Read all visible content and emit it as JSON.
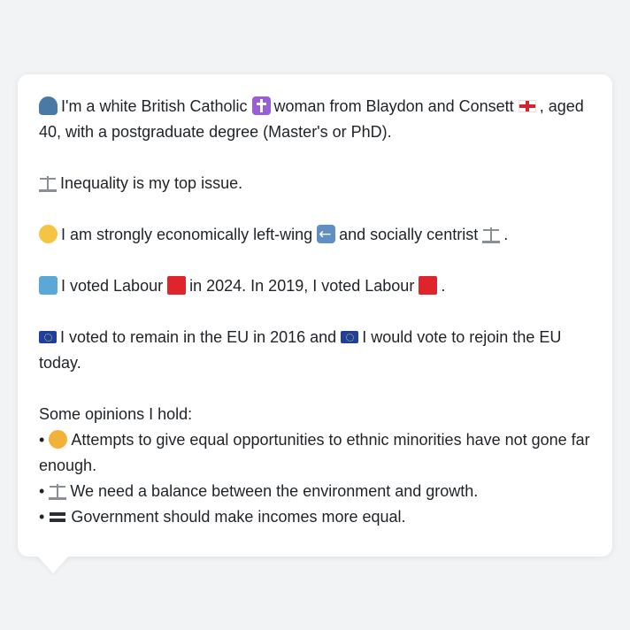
{
  "profile": {
    "intro_1": "I'm a white British Catholic",
    "intro_2": "woman from Blaydon and Consett",
    "intro_3": ", aged 40, with a postgraduate degree (Master's or PhD).",
    "top_issue": "Inequality is my top issue.",
    "ideology_1": "I am strongly economically left-wing",
    "ideology_2": "and socially centrist",
    "ideology_3": ".",
    "vote_1": "I voted Labour",
    "vote_2": "in 2024. In 2019, I voted Labour",
    "vote_3": ".",
    "eu_1": "I voted to remain in the EU in 2016 and",
    "eu_2": "I would vote to rejoin the EU today.",
    "opinions_heading": "Some opinions I hold:",
    "opinions": [
      "Attempts to give equal opportunities to ethnic minorities have not gone far enough.",
      "We need a balance between the environment and growth.",
      "Government should make incomes more equal."
    ],
    "bullet_char": "•"
  },
  "icons": {
    "person": "person-icon",
    "cross": "cross-icon",
    "england_flag": "england-flag-icon",
    "scales": "scales-icon",
    "thinking": "thinking-face-icon",
    "left_arrow": "left-arrow-icon",
    "ballot": "ballot-box-icon",
    "labour": "red-square-icon",
    "eu": "eu-flag-icon",
    "handshake": "handshake-icon",
    "equals": "equals-icon"
  },
  "colors": {
    "background": "#f1f3f5",
    "card": "#ffffff",
    "text": "#1f2328",
    "labour_red": "#e0242b",
    "eu_blue": "#1f3f9c"
  }
}
